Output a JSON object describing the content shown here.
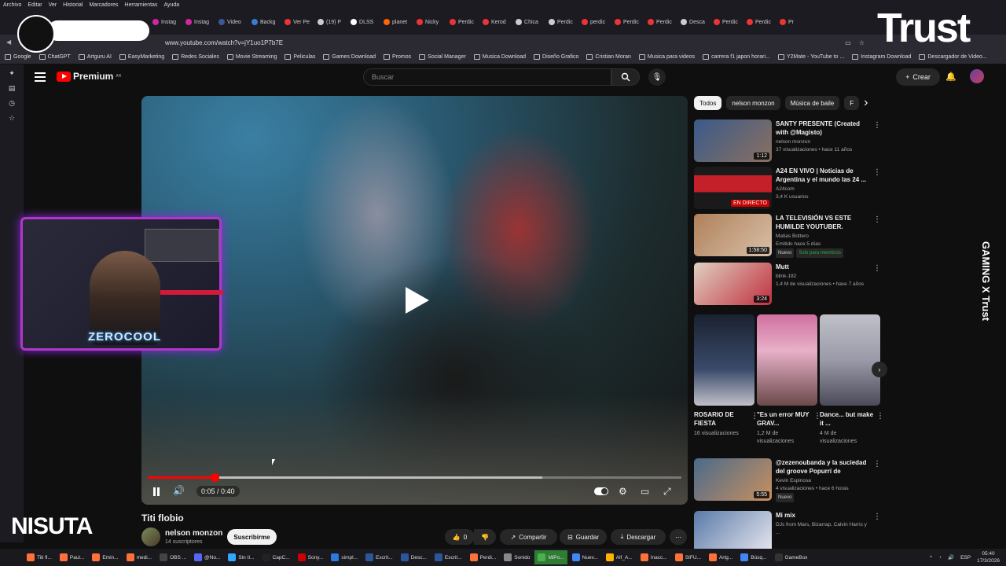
{
  "browser": {
    "menu": [
      "Archivo",
      "Editar",
      "Ver",
      "Historial",
      "Marcadores",
      "Herramientas",
      "Ayuda"
    ],
    "tabs": [
      "Instag",
      "Instag",
      "Video",
      "Backg",
      "Ver Pe",
      "(19) P",
      "DLSS",
      "planet",
      "Nicky",
      "Perdic",
      "Kerod",
      "Chica",
      "Perdic",
      "perdic",
      "Perdic",
      "Perdic",
      "Desca",
      "Perdic",
      "Perdic",
      "Pr"
    ],
    "url": "www.youtube.com/watch?v=jY1uo1P7b7E",
    "bookmarks": [
      "Google",
      "ChatGPT",
      "Artguru AI",
      "EasyMarketing",
      "Redes Sociales",
      "Movie Streaming",
      "Peliculas",
      "Games Download",
      "Promos",
      "Social Manager",
      "Musica Download",
      "Diseño Grafico",
      "Cristian Moran",
      "Musica para videos",
      "carrera f1 japon horari...",
      "Y2Mate - YouTube to ...",
      "Instagram Download",
      "Descargador de Video..."
    ]
  },
  "overlay": {
    "brand_trust": "Trust",
    "streamer_name": "ZEROCOOL",
    "nisuta": "NISUTA",
    "gaming_trust": "GAMING X Trust",
    "cam_initials": "LL"
  },
  "youtube": {
    "logo": "Premium",
    "country": "AR",
    "search_placeholder": "Buscar",
    "create_label": "Crear",
    "player": {
      "current_time": "0:05",
      "duration": "0:40",
      "progress_fraction": 0.125,
      "loaded_fraction": 0.74
    },
    "video_title": "Titi flobio",
    "channel_name": "nelson monzon",
    "subscribers": "14 suscriptores",
    "subscribe_label": "Suscribirme",
    "likes": "0",
    "share_label": "Compartir",
    "save_label": "Guardar",
    "download_label": "Descargar",
    "chips": [
      "Todos",
      "nelson monzon",
      "Música de baile",
      "F"
    ],
    "recommendations": [
      {
        "title": "SANTY PRESENTE (Created with @Magisto)",
        "channel": "nelson monzon",
        "meta": "37 visualizaciones • hace 11 años",
        "duration": "1:12",
        "badges": []
      },
      {
        "title": "A24 EN VIVO | Noticias de Argentina y el mundo las 24 ...",
        "channel": "A24com",
        "meta": "3,4 K usuarios",
        "duration": "EN DIRECTO",
        "badges": []
      },
      {
        "title": "LA TELEVISIÓN VS ESTE HUMILDE YOUTUBER.",
        "channel": "Matias Bottero",
        "meta": "Emitido hace 5 días",
        "duration": "1:58:50",
        "badges": [
          "Nuevo",
          "Solo para miembros"
        ]
      },
      {
        "title": "Mutt",
        "channel": "blink-182",
        "meta": "1,4 M de visualizaciones • hace 7 años",
        "duration": "3:24",
        "badges": []
      }
    ],
    "shorts": [
      {
        "title": "ROSARIO DE FIESTA",
        "views": "16 visualizaciones"
      },
      {
        "title": "\"Es un error MUY GRAV...",
        "views": "1,2 M de visualizaciones"
      },
      {
        "title": "Dance... but make it ...",
        "views": "4 M de visualizaciones"
      }
    ],
    "rec_more": [
      {
        "title": "@zezenoubanda y la suciedad del groove Popurrí de clásicos...",
        "channel": "Kevin Espinosa",
        "meta": "4 visualizaciones • hace 6 horas",
        "duration": "5:55",
        "badges": [
          "Nuevo"
        ]
      },
      {
        "title": "Mi mix",
        "channel": "DJs from Mars, Bizarrap, Calvin Harris y ...",
        "meta": "",
        "duration": "",
        "badges": []
      }
    ]
  },
  "taskbar": {
    "apps": [
      "Titi fl...",
      "Paul...",
      "Emin...",
      "medi...",
      "OBS ...",
      "@No...",
      "Sin tí...",
      "CapC...",
      "Sony...",
      "simpl...",
      "Escrit...",
      "Desc...",
      "Escrit...",
      "Perdi...",
      "Sonido",
      "MiPo...",
      "Nuev...",
      "Alf_A...",
      "Inacc...",
      "SIFU...",
      "Artg...",
      "Búsq...",
      "GameBox"
    ],
    "lang": "ESP",
    "time": "05:40",
    "date": "17/3/2026"
  }
}
